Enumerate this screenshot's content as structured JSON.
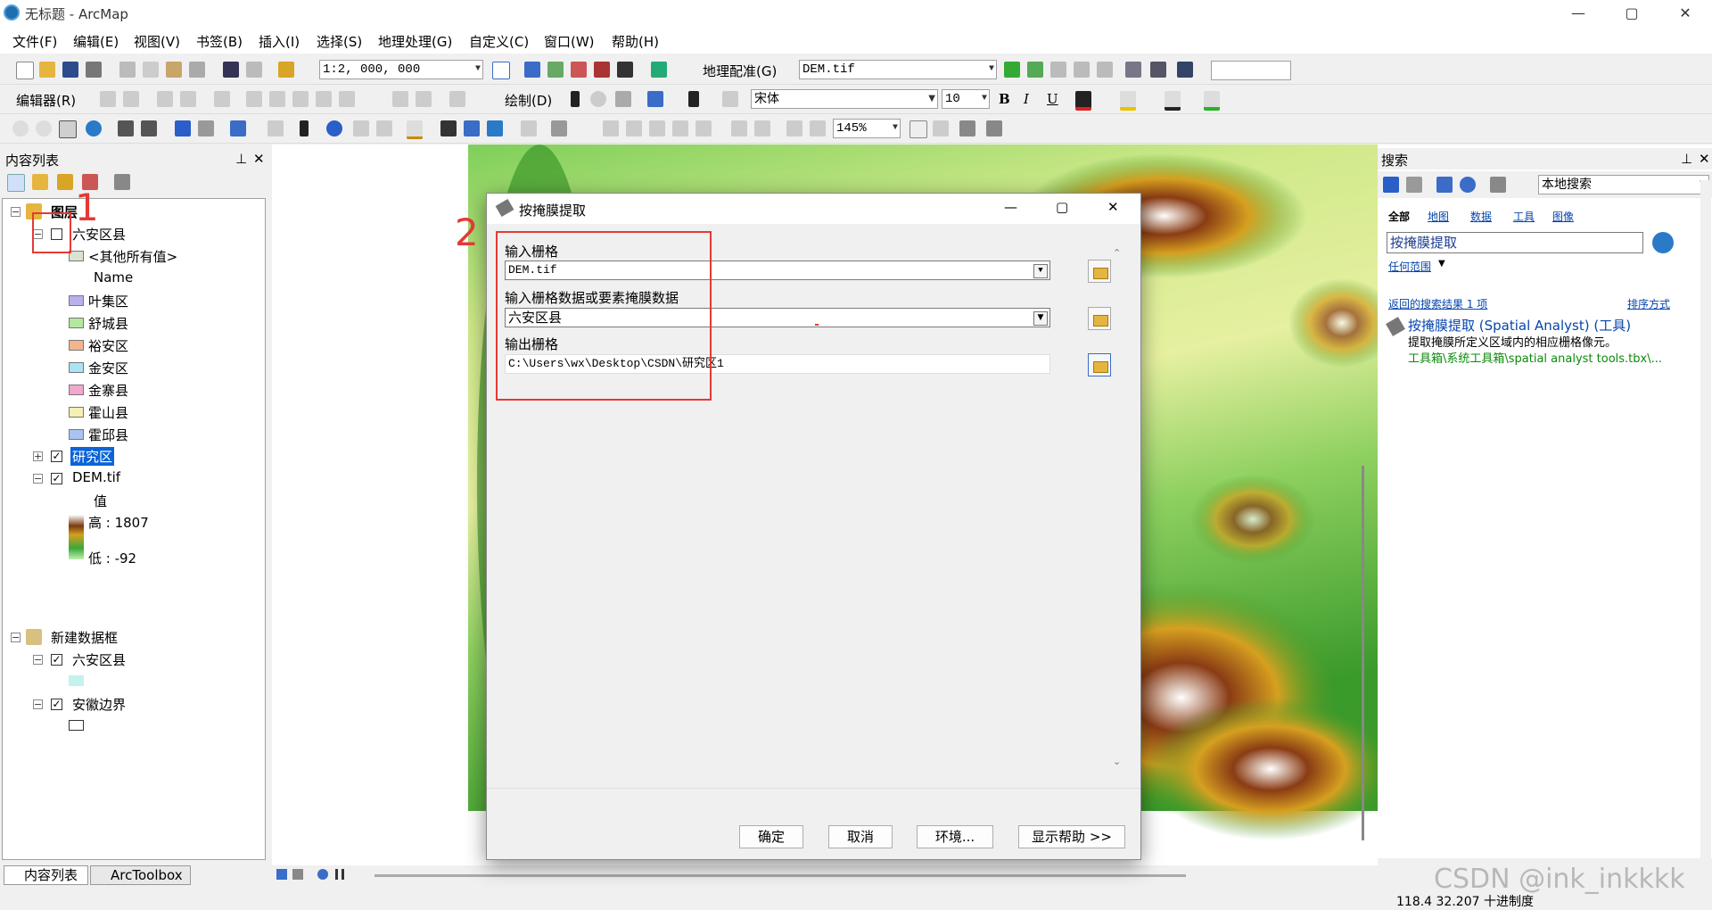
{
  "window": {
    "title": "无标题 - ArcMap",
    "minimize": "—",
    "maximize": "▢",
    "close": "✕"
  },
  "menu": [
    "文件(F)",
    "编辑(E)",
    "视图(V)",
    "书签(B)",
    "插入(I)",
    "选择(S)",
    "地理处理(G)",
    "自定义(C)",
    "窗口(W)",
    "帮助(H)"
  ],
  "toolbar": {
    "scale": "1:2, 000, 000",
    "georef_label": "地理配准(G)",
    "georef_layer": "DEM.tif",
    "editor_label": "编辑器(R)",
    "draw_label": "绘制(D)",
    "font": "宋体",
    "font_size": "10",
    "zoom": "145%",
    "bold": "B",
    "italic": "I",
    "underline": "U"
  },
  "toc": {
    "title": "内容列表",
    "pin": "⊥",
    "close": "✕",
    "layers_label": "图层",
    "layer1": {
      "name": "六安区县",
      "checked": false,
      "other": "<其他所有值>",
      "field": "Name",
      "items": [
        {
          "label": "叶集区",
          "color": "#b8b0ec"
        },
        {
          "label": "舒城县",
          "color": "#b4e8a0"
        },
        {
          "label": "裕安区",
          "color": "#f5b48c"
        },
        {
          "label": "金安区",
          "color": "#a8e4f4"
        },
        {
          "label": "金寨县",
          "color": "#f0a8cc"
        },
        {
          "label": "霍山县",
          "color": "#f4f0b4"
        },
        {
          "label": "霍邱县",
          "color": "#a8c4f0"
        }
      ]
    },
    "layer2": {
      "name": "研究区",
      "checked": true
    },
    "layer3": {
      "name": "DEM.tif",
      "checked": true,
      "value_label": "值",
      "high": "高 : 1807",
      "low": "低 : -92"
    },
    "frame2": {
      "name": "新建数据框",
      "layer_a": {
        "name": "六安区县",
        "checked": true,
        "color": "#c4f2ec"
      },
      "layer_b": {
        "name": "安徽边界",
        "checked": true
      }
    },
    "tabs": [
      "内容列表",
      "ArcToolbox"
    ]
  },
  "dialog": {
    "title": "按掩膜提取",
    "in_raster_label": "输入栅格",
    "in_raster": "DEM.tif",
    "mask_label": "输入栅格数据或要素掩膜数据",
    "mask": "六安区县",
    "out_label": "输出栅格",
    "out": "C:\\Users\\wx\\Desktop\\CSDN\\研究区1",
    "ok": "确定",
    "cancel": "取消",
    "env": "环境...",
    "help": "显示帮助 >>"
  },
  "annotations": {
    "n1": "1",
    "n2": "2"
  },
  "search": {
    "title": "搜索",
    "scope": "本地搜索",
    "tabs": [
      "全部",
      "地图",
      "数据",
      "工具",
      "图像"
    ],
    "query": "按掩膜提取",
    "any_extent": "任何范围",
    "results_count": "返回的搜索结果 1 项",
    "sort": "排序方式",
    "result": {
      "title": "按掩膜提取 (Spatial Analyst) (工具)",
      "desc": "提取掩膜所定义区域内的相应栅格像元。",
      "path": "工具箱\\系统工具箱\\spatial analyst tools.tbx\\..."
    }
  },
  "status": {
    "coords": "118.4  32.207 十进制度",
    "watermark": "CSDN @ink_inkkkk"
  }
}
